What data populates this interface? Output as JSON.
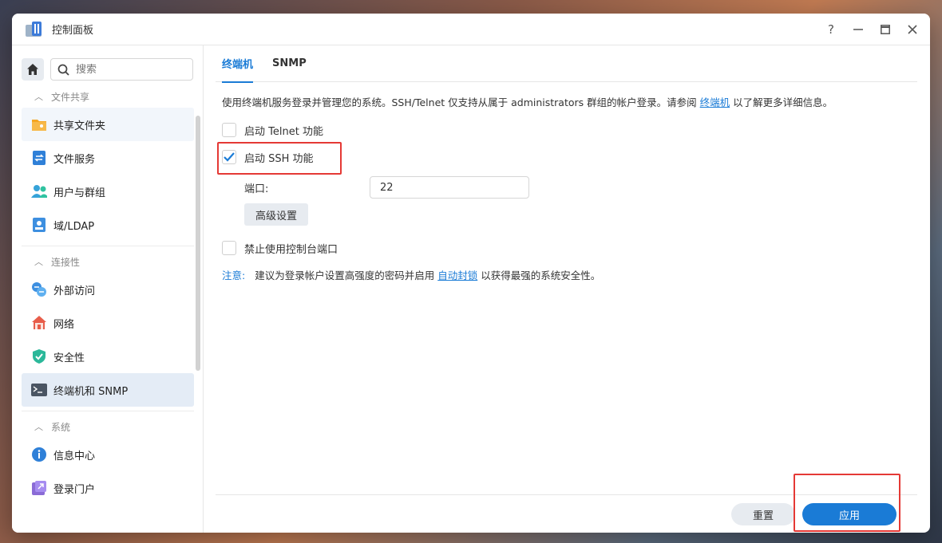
{
  "window": {
    "title": "控制面板"
  },
  "titlebar_buttons": {
    "help": "?",
    "minimize": "—",
    "maximize": "▭",
    "close": "✕"
  },
  "sidebar": {
    "search_placeholder": "搜索",
    "sections": [
      {
        "label": "文件共享",
        "items": [
          {
            "label": "共享文件夹",
            "icon": "folder-icon"
          },
          {
            "label": "文件服务",
            "icon": "file-services-icon"
          },
          {
            "label": "用户与群组",
            "icon": "users-icon"
          },
          {
            "label": "域/LDAP",
            "icon": "domain-ldap-icon"
          }
        ]
      },
      {
        "label": "连接性",
        "items": [
          {
            "label": "外部访问",
            "icon": "external-access-icon"
          },
          {
            "label": "网络",
            "icon": "network-icon"
          },
          {
            "label": "安全性",
            "icon": "security-shield-icon"
          },
          {
            "label": "终端机和 SNMP",
            "icon": "terminal-icon",
            "active": true
          }
        ]
      },
      {
        "label": "系统",
        "items": [
          {
            "label": "信息中心",
            "icon": "info-icon"
          },
          {
            "label": "登录门户",
            "icon": "login-portal-icon"
          }
        ]
      }
    ]
  },
  "tabs": [
    {
      "label": "终端机",
      "active": true
    },
    {
      "label": "SNMP",
      "active": false
    }
  ],
  "content": {
    "desc_prefix": "使用终端机服务登录并管理您的系统。SSH/Telnet 仅支持从属于 administrators 群组的帐户登录。请参阅",
    "desc_link": "终端机",
    "desc_suffix": "以了解更多详细信息。",
    "telnet_label": "启动 Telnet 功能",
    "telnet_checked": false,
    "ssh_label": "启动 SSH 功能",
    "ssh_checked": true,
    "port_label": "端口:",
    "port_value": "22",
    "advanced_button": "高级设置",
    "console_label": "禁止使用控制台端口",
    "console_checked": false,
    "note_key": "注意:",
    "note_prefix": "建议为登录帐户设置高强度的密码并启用",
    "note_link": "自动封锁",
    "note_suffix": "以获得最强的系统安全性。"
  },
  "footer": {
    "reset_label": "重置",
    "apply_label": "应用"
  },
  "colors": {
    "accent": "#1a7bd6",
    "highlight_box": "#e53935",
    "active_item_bg": "#e4ecf6"
  }
}
